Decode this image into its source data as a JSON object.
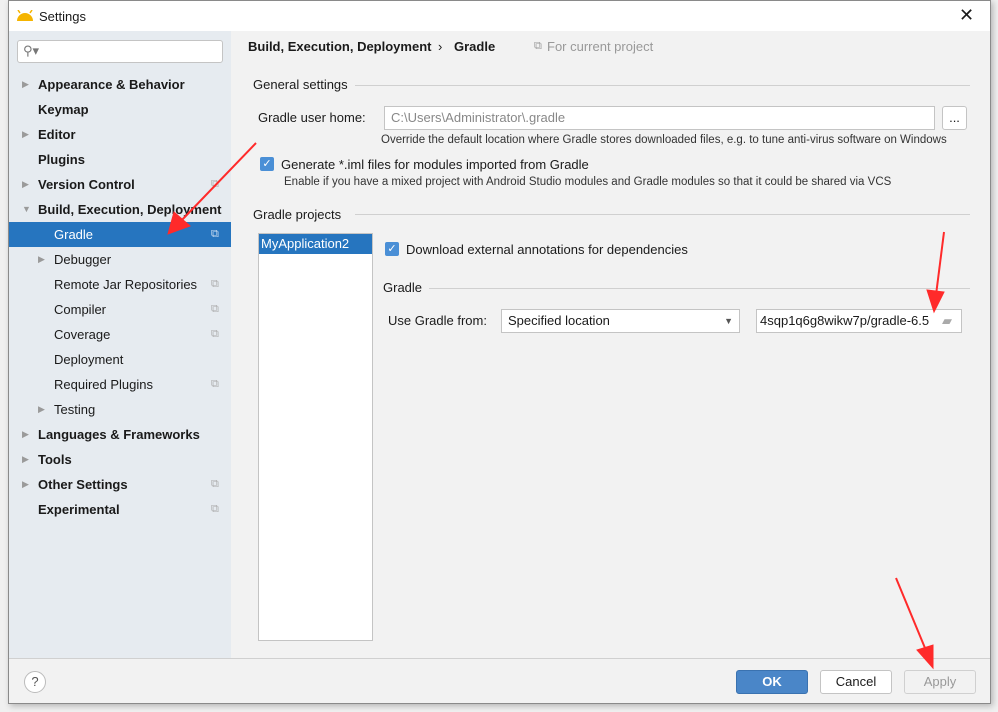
{
  "window": {
    "title": "Settings",
    "close_icon": "close-icon"
  },
  "sidebar": {
    "search_placeholder": "",
    "items": [
      {
        "label": "Appearance & Behavior",
        "level": 0,
        "expandable": true
      },
      {
        "label": "Keymap",
        "level": 0,
        "expandable": false
      },
      {
        "label": "Editor",
        "level": 0,
        "expandable": true
      },
      {
        "label": "Plugins",
        "level": 0,
        "expandable": false
      },
      {
        "label": "Version Control",
        "level": 0,
        "expandable": true,
        "project": true
      },
      {
        "label": "Build, Execution, Deployment",
        "level": 0,
        "expanded": true
      },
      {
        "label": "Gradle",
        "level": 1,
        "selected": true,
        "project": true
      },
      {
        "label": "Debugger",
        "level": 1,
        "expandable": true
      },
      {
        "label": "Remote Jar Repositories",
        "level": 1,
        "project": true
      },
      {
        "label": "Compiler",
        "level": 1,
        "project": true
      },
      {
        "label": "Coverage",
        "level": 1,
        "project": true
      },
      {
        "label": "Deployment",
        "level": 1
      },
      {
        "label": "Required Plugins",
        "level": 1,
        "project": true
      },
      {
        "label": "Testing",
        "level": 1,
        "expandable": true
      },
      {
        "label": "Languages & Frameworks",
        "level": 0,
        "expandable": true
      },
      {
        "label": "Tools",
        "level": 0,
        "expandable": true
      },
      {
        "label": "Other Settings",
        "level": 0,
        "expandable": true,
        "project": true
      },
      {
        "label": "Experimental",
        "level": 0,
        "project": true
      }
    ]
  },
  "breadcrumb": {
    "parent": "Build, Execution, Deployment",
    "separator": "›",
    "current": "Gradle",
    "scope": "For current project"
  },
  "general": {
    "title": "General settings",
    "user_home_label": "Gradle user home:",
    "user_home_value": "C:\\Users\\Administrator\\.gradle",
    "browse_label": "...",
    "user_home_hint": "Override the default location where Gradle stores downloaded files, e.g. to tune anti-virus software on Windows",
    "iml_label": "Generate *.iml files for modules imported from Gradle",
    "iml_checked": true,
    "iml_hint": "Enable if you have a mixed project with Android Studio modules and Gradle modules so that it could be shared via VCS"
  },
  "projects": {
    "title": "Gradle projects",
    "list": [
      "MyApplication2"
    ],
    "download_annotations_label": "Download external annotations for dependencies",
    "download_annotations_checked": true,
    "gradle_section": "Gradle",
    "use_from_label": "Use Gradle from:",
    "use_from_value": "Specified location",
    "location_value": "4sqp1q6g8wikw7p/gradle-6.5"
  },
  "footer": {
    "help": "?",
    "ok": "OK",
    "cancel": "Cancel",
    "apply": "Apply"
  },
  "colors": {
    "accent": "#2675bf",
    "annotation": "#ff2a2a"
  }
}
